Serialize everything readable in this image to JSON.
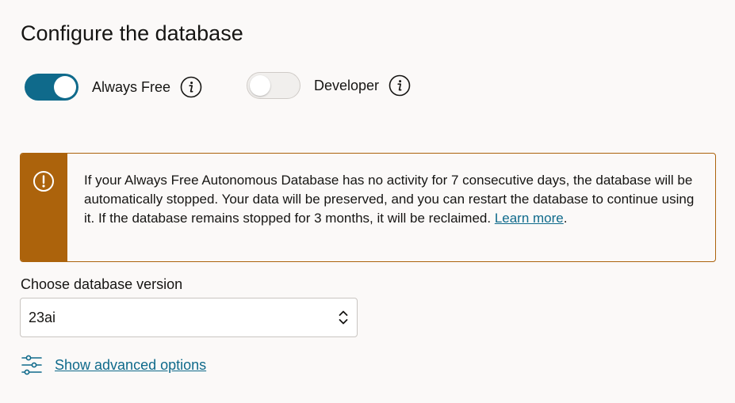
{
  "page": {
    "title": "Configure the database"
  },
  "toggles": {
    "always_free": {
      "label": "Always Free",
      "state": "on"
    },
    "developer": {
      "label": "Developer",
      "state": "off"
    }
  },
  "alert": {
    "type": "warning",
    "icon": "exclamation-circle-icon",
    "message": "If your Always Free Autonomous Database has no activity for 7 consecutive days, the database will be automatically stopped. Your data will be preserved, and you can restart the database to continue using it. If the database remains stopped for 3 months, it will be reclaimed.",
    "link_label": "Learn more",
    "trailing": "."
  },
  "version": {
    "label": "Choose database version",
    "selected": "23ai"
  },
  "advanced": {
    "link_label": "Show advanced options"
  },
  "colors": {
    "accent": "#0f6a8b",
    "warning": "#ac630c",
    "background": "#fbf9f8",
    "text": "#161513"
  }
}
